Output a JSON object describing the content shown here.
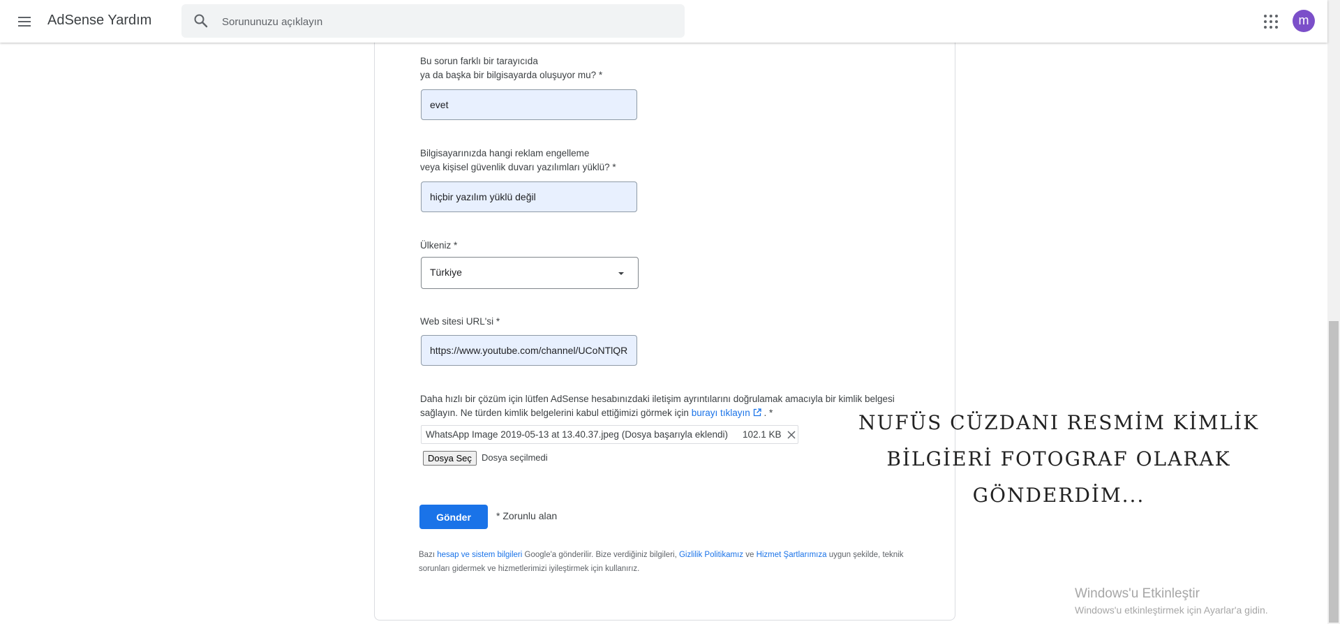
{
  "header": {
    "app_title": "AdSense Yardım",
    "search_placeholder": "Sorununuzu açıklayın",
    "avatar_letter": "m"
  },
  "form": {
    "browser_question_line1": "Bu sorun farklı bir tarayıcıda",
    "browser_question_line2": "ya da başka bir bilgisayarda oluşuyor mu? *",
    "browser_answer": "evet",
    "adblock_question_line1": "Bilgisayarınızda hangi reklam engelleme",
    "adblock_question_line2": "veya kişisel güvenlik duvarı yazılımları yüklü? *",
    "adblock_answer": "hiçbir yazılım yüklü değil",
    "country_label": "Ülkeniz *",
    "country_value": "Türkiye",
    "url_label": "Web sitesi URL'si *",
    "url_value": "https://www.youtube.com/channel/UCoNTlQR",
    "id_text": "Daha hızlı bir çözüm için lütfen AdSense hesabınızdaki iletişim ayrıntılarını doğrulamak amacıyla bir kimlik belgesi sağlayın. Ne türden kimlik belgelerini kabul ettiğimizi görmek için",
    "id_link": "burayı tıklayın",
    "id_suffix": ". *",
    "file_name": "WhatsApp Image 2019-05-13 at 13.40.37.jpeg (Dosya başarıyla eklendi)",
    "file_size": "102.1 KB",
    "choose_file_label": "Dosya Seç",
    "no_file_text": "Dosya seçilmedi",
    "submit_label": "Gönder",
    "required_note": "* Zorunlu alan"
  },
  "footer": {
    "part1": "Bazı",
    "link1": "hesap ve sistem bilgileri",
    "part2": "Google'a gönderilir. Bize verdiğiniz bilgileri,",
    "link2": "Gizlilik Politikamız",
    "part3": "ve",
    "link3": "Hizmet Şartlarımıza",
    "part4": "uygun şekilde, teknik sorunları gidermek ve hizmetlerimizi iyileştirmek için kullanırız."
  },
  "overlay": {
    "line1": "NUFÜS CÜZDANI RESMİM KİMLİK",
    "line2": "BİLGİERİ FOTOGRAF OLARAK",
    "line3": "GÖNDERDİM..."
  },
  "windows": {
    "title": "Windows'u Etkinleştir",
    "subtitle": "Windows'u etkinleştirmek için Ayarlar'a gidin."
  },
  "colors": {
    "accent": "#1a73e8",
    "avatar": "#7b4fc9",
    "field_fill": "#e8f0fe"
  }
}
